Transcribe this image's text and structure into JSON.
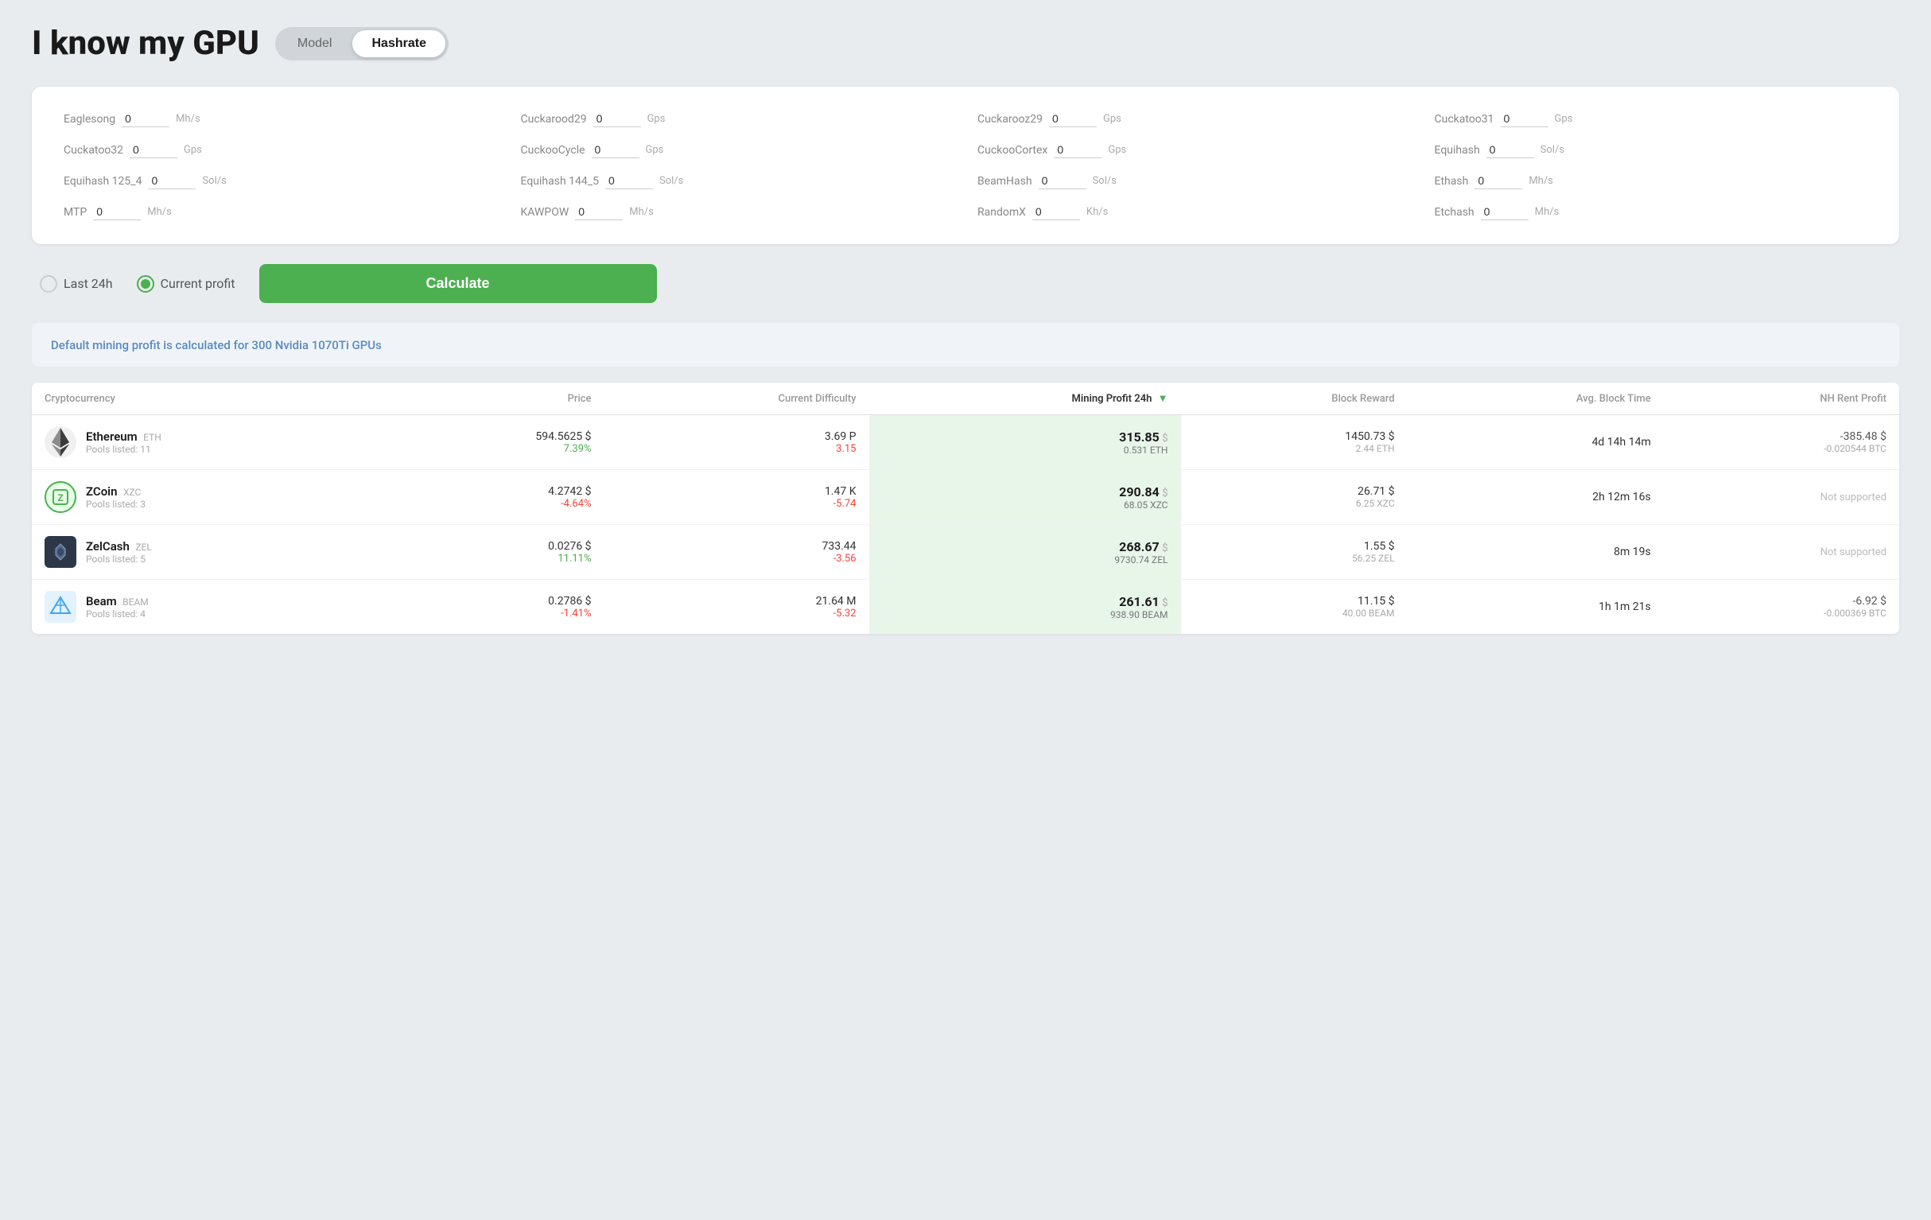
{
  "header": {
    "title": "I know my GPU",
    "toggle": {
      "model_label": "Model",
      "hashrate_label": "Hashrate",
      "active": "hashrate"
    }
  },
  "hashrate_panel": {
    "fields": [
      {
        "label": "Eaglesong",
        "value": "0",
        "unit": "Mh/s"
      },
      {
        "label": "Cuckarood29",
        "value": "0",
        "unit": "Gps"
      },
      {
        "label": "Cuckarooz29",
        "value": "0",
        "unit": "Gps"
      },
      {
        "label": "Cuckatoo31",
        "value": "0",
        "unit": "Gps"
      },
      {
        "label": "Cuckatoo32",
        "value": "0",
        "unit": "Gps"
      },
      {
        "label": "CuckooCycle",
        "value": "0",
        "unit": "Gps"
      },
      {
        "label": "CuckooCortex",
        "value": "0",
        "unit": "Gps"
      },
      {
        "label": "Equihash",
        "value": "0",
        "unit": "Sol/s"
      },
      {
        "label": "Equihash 125_4",
        "value": "0",
        "unit": "Sol/s"
      },
      {
        "label": "Equihash 144_5",
        "value": "0",
        "unit": "Sol/s"
      },
      {
        "label": "BeamHash",
        "value": "0",
        "unit": "Sol/s"
      },
      {
        "label": "Ethash",
        "value": "0",
        "unit": "Mh/s"
      },
      {
        "label": "MTP",
        "value": "0",
        "unit": "Mh/s"
      },
      {
        "label": "KAWPOW",
        "value": "0",
        "unit": "Mh/s"
      },
      {
        "label": "RandomX",
        "value": "0",
        "unit": "Kh/s"
      },
      {
        "label": "Etchash",
        "value": "0",
        "unit": "Mh/s"
      }
    ]
  },
  "controls": {
    "last24h_label": "Last 24h",
    "current_profit_label": "Current profit",
    "calculate_label": "Calculate",
    "selected": "current_profit"
  },
  "info_banner": {
    "text": "Default mining profit is calculated for 300 Nvidia 1070Ti GPUs"
  },
  "table": {
    "columns": [
      {
        "key": "coin",
        "label": "Cryptocurrency"
      },
      {
        "key": "price",
        "label": "Price"
      },
      {
        "key": "difficulty",
        "label": "Current Difficulty"
      },
      {
        "key": "profit",
        "label": "Mining Profit 24h",
        "sorted": true
      },
      {
        "key": "block_reward",
        "label": "Block Reward"
      },
      {
        "key": "block_time",
        "label": "Avg. Block Time"
      },
      {
        "key": "nh_profit",
        "label": "NH Rent Profit"
      }
    ],
    "rows": [
      {
        "coin_name": "Ethereum",
        "coin_ticker": "ETH",
        "coin_pools": "Pools listed: 11",
        "icon_type": "eth",
        "price_main": "594.5625 $",
        "price_change": "7.39%",
        "price_change_positive": true,
        "difficulty_main": "3.69 P",
        "difficulty_change": "3.15",
        "difficulty_change_positive": false,
        "profit_main": "315.85",
        "profit_currency": "$",
        "profit_sub": "0.531 ETH",
        "block_main": "1450.73 $",
        "block_sub": "2.44 ETH",
        "block_time": "4d 14h 14m",
        "nh_main": "-385.48 $",
        "nh_sub": "-0.020544 BTC"
      },
      {
        "coin_name": "ZCoin",
        "coin_ticker": "XZC",
        "coin_pools": "Pools listed: 3",
        "icon_type": "zcoin",
        "price_main": "4.2742 $",
        "price_change": "-4.64%",
        "price_change_positive": false,
        "difficulty_main": "1.47 K",
        "difficulty_change": "-5.74",
        "difficulty_change_positive": false,
        "profit_main": "290.84",
        "profit_currency": "$",
        "profit_sub": "68.05 XZC",
        "block_main": "26.71 $",
        "block_sub": "6.25 XZC",
        "block_time": "2h 12m 16s",
        "nh_main": "Not supported",
        "nh_sub": ""
      },
      {
        "coin_name": "ZelCash",
        "coin_ticker": "ZEL",
        "coin_pools": "Pools listed: 5",
        "icon_type": "zelcash",
        "price_main": "0.0276 $",
        "price_change": "11.11%",
        "price_change_positive": true,
        "difficulty_main": "733.44",
        "difficulty_change": "-3.56",
        "difficulty_change_positive": false,
        "profit_main": "268.67",
        "profit_currency": "$",
        "profit_sub": "9730.74 ZEL",
        "block_main": "1.55 $",
        "block_sub": "56.25 ZEL",
        "block_time": "8m 19s",
        "nh_main": "Not supported",
        "nh_sub": ""
      },
      {
        "coin_name": "Beam",
        "coin_ticker": "BEAM",
        "coin_pools": "Pools listed: 4",
        "icon_type": "beam",
        "price_main": "0.2786 $",
        "price_change": "-1.41%",
        "price_change_positive": false,
        "difficulty_main": "21.64 M",
        "difficulty_change": "-5.32",
        "difficulty_change_positive": false,
        "profit_main": "261.61",
        "profit_currency": "$",
        "profit_sub": "938.90 BEAM",
        "block_main": "11.15 $",
        "block_sub": "40.00 BEAM",
        "block_time": "1h 1m 21s",
        "nh_main": "-6.92 $",
        "nh_sub": "-0.000369 BTC"
      }
    ]
  }
}
